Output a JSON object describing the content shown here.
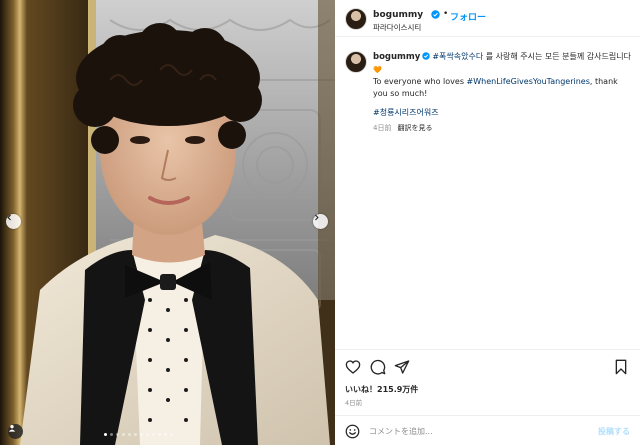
{
  "post": {
    "username": "bogummy",
    "follow_label": "フォロー",
    "separator": "•",
    "location": "파라다이스시티"
  },
  "caption": {
    "username": "bogummy",
    "hashtag1": "#폭싹속았수다",
    "korean_text": " 를 사랑해 주시는 모든 분들께 감사드립니다",
    "heart": "🧡",
    "english_prefix": "To everyone who loves ",
    "hashtag2": "#WhenLifeGivesYouTangerines",
    "english_suffix": ", thank you so much!",
    "hashtag3": "#청룡시리즈어워즈",
    "time_ago": "4日前",
    "see_translation": "翻訳を見る"
  },
  "engagement": {
    "likes_text": "いいね！215.9万件",
    "date_text": "4日前"
  },
  "comment": {
    "placeholder": "コメントを追加...",
    "post_label": "投稿する"
  },
  "carousel": {
    "total_slides": 12,
    "active_slide": 1
  },
  "colors": {
    "accent_blue": "#0095f6",
    "hashtag_blue": "#00376b",
    "verified_blue": "#0095f6",
    "muted_gray": "#8e8e8e"
  },
  "icons": {
    "like": "heart-outline-icon",
    "comment": "speech-bubble-icon",
    "share": "paper-plane-icon",
    "save": "bookmark-icon",
    "emoji": "smiley-icon",
    "prev": "chevron-left-icon",
    "next": "chevron-right-icon",
    "tagged_user": "person-icon",
    "verified": "verified-badge-icon"
  }
}
